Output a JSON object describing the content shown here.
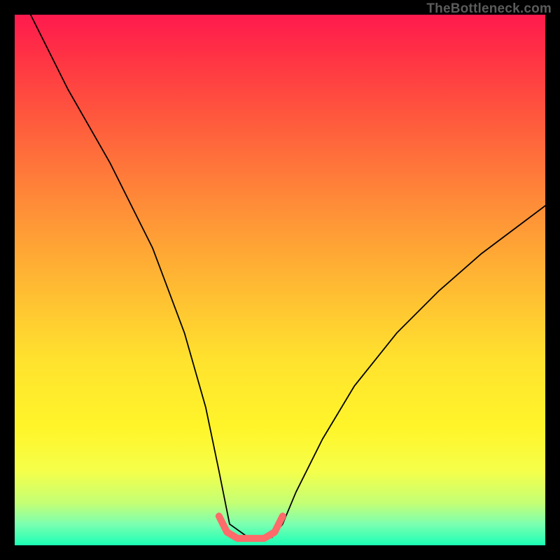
{
  "watermark": "TheBottleneck.com",
  "chart_data": {
    "type": "line",
    "title": "",
    "xlabel": "",
    "ylabel": "",
    "xlim": [
      0,
      100
    ],
    "ylim": [
      0,
      100
    ],
    "series": [
      {
        "name": "bottleneck-curve",
        "x": [
          3,
          10,
          18,
          26,
          32,
          36,
          38.5,
          40.5,
          44,
          48.5,
          50.5,
          53,
          58,
          64,
          72,
          80,
          88,
          96,
          100
        ],
        "y": [
          100,
          86,
          72,
          56,
          40,
          26,
          14,
          4,
          1.5,
          1.5,
          4,
          10,
          20,
          30,
          40,
          48,
          55,
          61,
          64
        ],
        "color": "#000000",
        "width": 1.8
      },
      {
        "name": "optimal-segment",
        "x": [
          38.5,
          40,
          42,
          44,
          47,
          49,
          50.5
        ],
        "y": [
          5.5,
          2.5,
          1.3,
          1.3,
          1.3,
          2.5,
          5.5
        ],
        "color": "#ff6a6a",
        "width": 10
      }
    ],
    "gradient_stops": [
      {
        "pos": 0,
        "color": "#ff1a4e"
      },
      {
        "pos": 8,
        "color": "#ff3344"
      },
      {
        "pos": 20,
        "color": "#ff5a3d"
      },
      {
        "pos": 35,
        "color": "#ff8a38"
      },
      {
        "pos": 50,
        "color": "#ffb733"
      },
      {
        "pos": 65,
        "color": "#ffe22e"
      },
      {
        "pos": 78,
        "color": "#fff52a"
      },
      {
        "pos": 86,
        "color": "#f5ff4a"
      },
      {
        "pos": 92,
        "color": "#c4ff74"
      },
      {
        "pos": 96,
        "color": "#7cffb0"
      },
      {
        "pos": 100,
        "color": "#1affb5"
      }
    ]
  }
}
